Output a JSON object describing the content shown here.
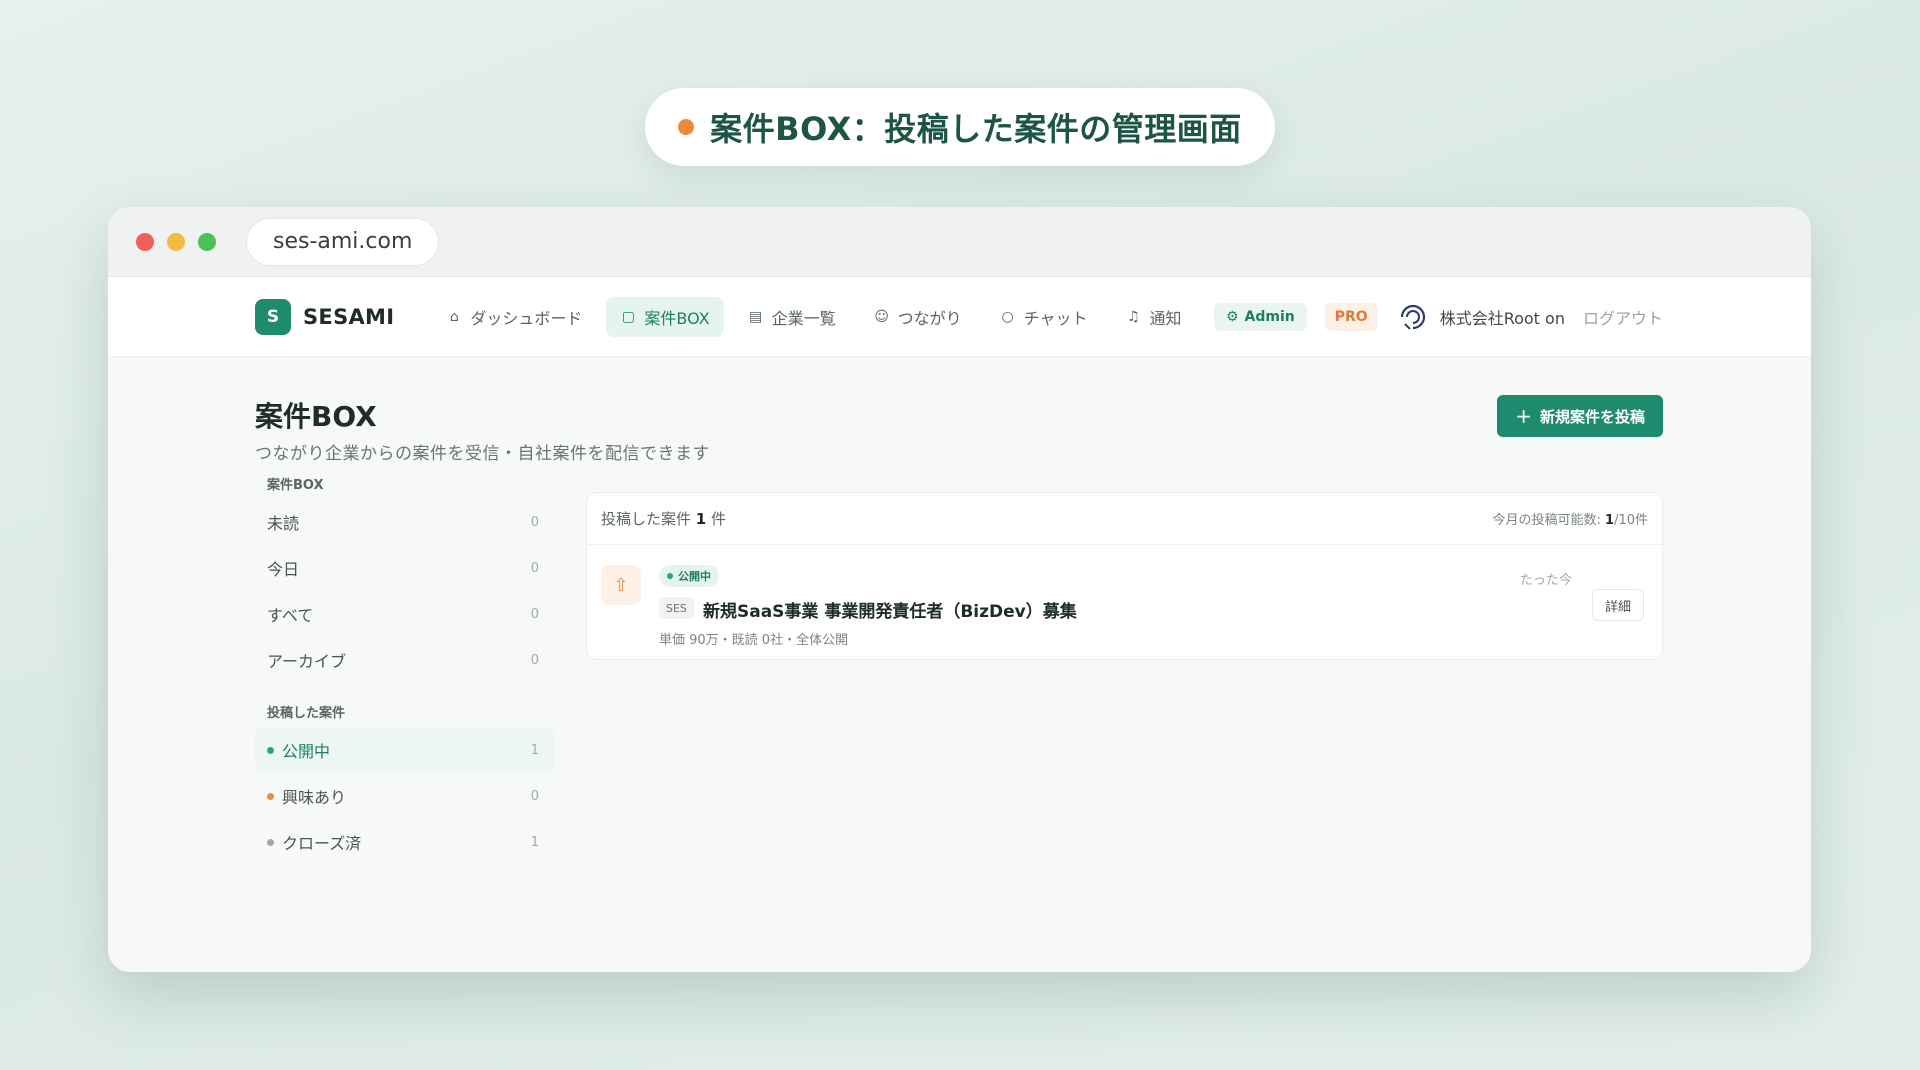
{
  "caption": {
    "text": "案件BOX：投稿した案件の管理画面"
  },
  "browser": {
    "url": "ses-ami.com"
  },
  "nav": {
    "logo_mark": "S",
    "logo_text": "SESAMI",
    "items": [
      {
        "label": "ダッシュボード",
        "icon": "home-icon"
      },
      {
        "label": "案件BOX",
        "icon": "box-icon",
        "active": true
      },
      {
        "label": "企業一覧",
        "icon": "building-icon"
      },
      {
        "label": "つながり",
        "icon": "people-icon"
      },
      {
        "label": "チャット",
        "icon": "chat-icon"
      },
      {
        "label": "通知",
        "icon": "bell-icon"
      }
    ],
    "admin": "Admin",
    "pro": "PRO",
    "company": "株式会社Root on",
    "logout": "ログアウト"
  },
  "page": {
    "title": "案件BOX",
    "subtitle": "つながり企業からの案件を受信・自社案件を配信できます",
    "new_button": "新規案件を投稿"
  },
  "sidebar": {
    "inbox_heading": "案件BOX",
    "inbox_items": [
      {
        "label": "未読",
        "count": "0"
      },
      {
        "label": "今日",
        "count": "0"
      },
      {
        "label": "すべて",
        "count": "0"
      },
      {
        "label": "アーカイブ",
        "count": "0"
      }
    ],
    "posted_heading": "投稿した案件",
    "posted_items": [
      {
        "label": "公開中",
        "count": "1",
        "dot_color": "#2aa37f",
        "active": true
      },
      {
        "label": "興味あり",
        "count": "0",
        "dot_color": "#ee8a3c"
      },
      {
        "label": "クローズ済",
        "count": "1",
        "dot_color": "#a2aaa8"
      }
    ]
  },
  "panel": {
    "head_prefix": "投稿した案件",
    "head_count": "1",
    "head_suffix": "件",
    "quota_label": "今月の投稿可能数:",
    "quota_value": "1",
    "quota_total": "/10件",
    "posts": [
      {
        "status": "公開中",
        "type": "SES",
        "title": "新規SaaS事業 事業開発責任者（BizDev）募集",
        "meta": "単価 90万・既読 0社・全体公開",
        "time": "たった今",
        "detail": "詳細"
      }
    ]
  },
  "colors": {
    "accent": "#1e8a6e",
    "orange": "#ee8a3c"
  }
}
